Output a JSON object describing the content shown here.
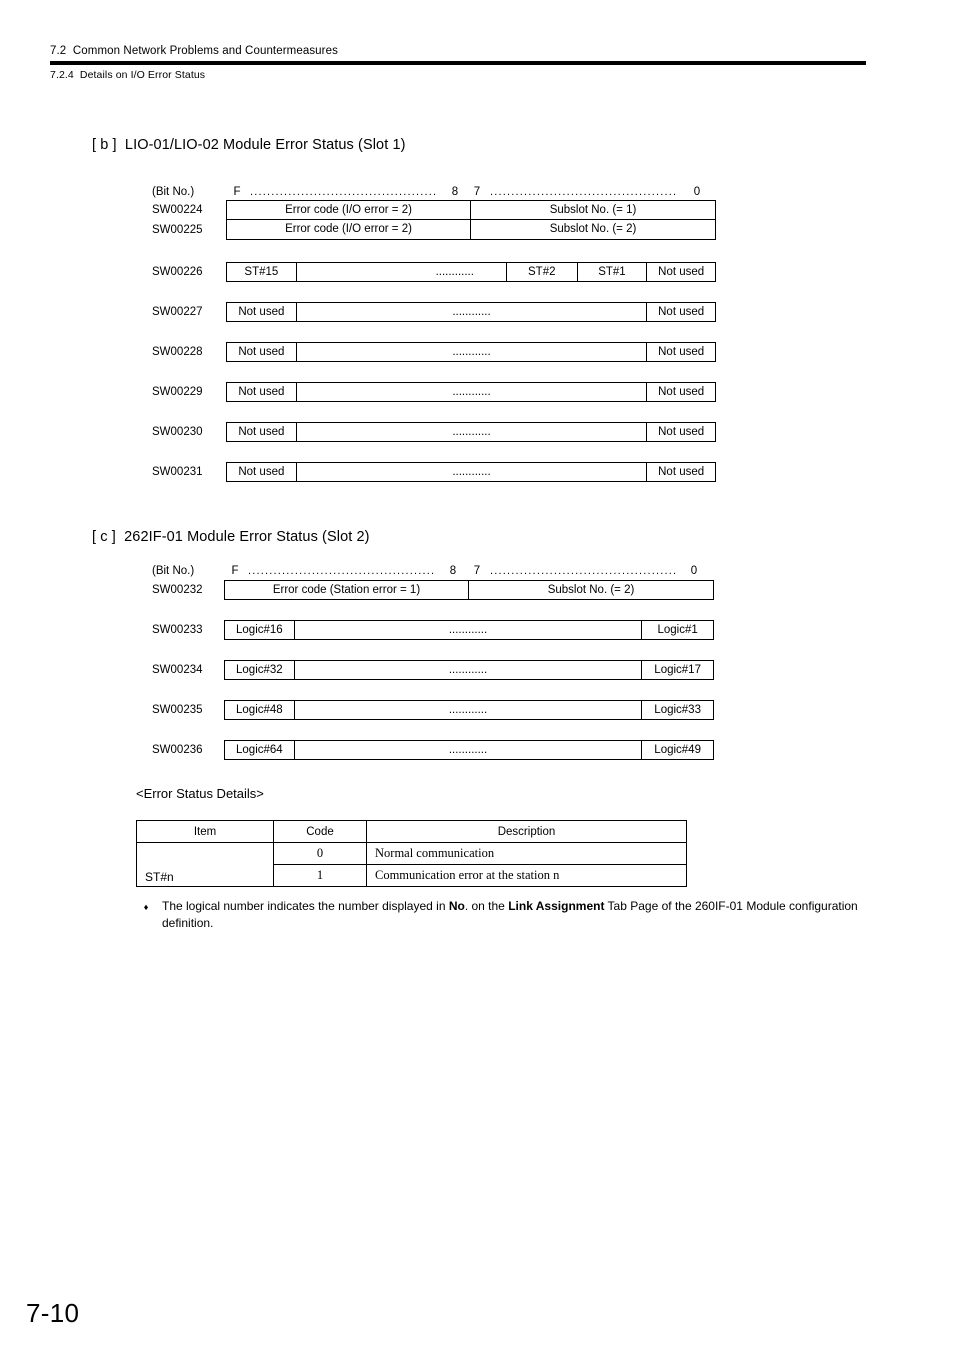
{
  "header": {
    "section": "7.2  Common Network Problems and Countermeasures",
    "subsection": "7.2.4  Details on I/O Error Status"
  },
  "sections": {
    "b": {
      "title": "[ b ]  LIO-01/LIO-02 Module Error Status (Slot 1)",
      "bit_ruler": {
        "label": "(Bit No.)",
        "msb": "F",
        "mid_high": "8",
        "mid_low": "7",
        "lsb": "0",
        "dots": "............................................"
      },
      "rows": [
        {
          "register": "SW00224",
          "cells": [
            {
              "text": "Error code (I/O error = 2)"
            },
            {
              "text": "Subslot No. (= 1)"
            }
          ]
        },
        {
          "register": "SW00225",
          "cells": [
            {
              "text": "Error code (I/O error = 2)"
            },
            {
              "text": "Subslot No. (= 2)"
            }
          ]
        },
        {
          "register": "SW00226",
          "cells": [
            {
              "text": "ST#15"
            },
            {
              "text": "............"
            },
            {
              "text": "ST#2"
            },
            {
              "text": "ST#1"
            },
            {
              "text": "Not used"
            }
          ]
        },
        {
          "register": "SW00227",
          "cells": [
            {
              "text": "Not used"
            },
            {
              "text": "............"
            },
            {
              "text": "Not used"
            }
          ]
        },
        {
          "register": "SW00228",
          "cells": [
            {
              "text": "Not used"
            },
            {
              "text": "............"
            },
            {
              "text": "Not used"
            }
          ]
        },
        {
          "register": "SW00229",
          "cells": [
            {
              "text": "Not used"
            },
            {
              "text": "............"
            },
            {
              "text": "Not used"
            }
          ]
        },
        {
          "register": "SW00230",
          "cells": [
            {
              "text": "Not used"
            },
            {
              "text": "............"
            },
            {
              "text": "Not used"
            }
          ]
        },
        {
          "register": "SW00231",
          "cells": [
            {
              "text": "Not used"
            },
            {
              "text": "............"
            },
            {
              "text": "Not used"
            }
          ]
        }
      ]
    },
    "c": {
      "title": "[ c ]  262IF-01 Module Error Status (Slot 2)",
      "bit_ruler": {
        "label": "(Bit No.)",
        "msb": "F",
        "mid_high": "8",
        "mid_low": "7",
        "lsb": "0",
        "dots": "............................................"
      },
      "rows": [
        {
          "register": "SW00232",
          "cells": [
            {
              "text": "Error code (Station error = 1)"
            },
            {
              "text": "Subslot No. (= 2)"
            }
          ]
        },
        {
          "register": "SW00233",
          "cells": [
            {
              "text": "Logic#16"
            },
            {
              "text": "............"
            },
            {
              "text": "Logic#1"
            }
          ]
        },
        {
          "register": "SW00234",
          "cells": [
            {
              "text": "Logic#32"
            },
            {
              "text": "............"
            },
            {
              "text": "Logic#17"
            }
          ]
        },
        {
          "register": "SW00235",
          "cells": [
            {
              "text": "Logic#48"
            },
            {
              "text": "............"
            },
            {
              "text": "Logic#33"
            }
          ]
        },
        {
          "register": "SW00236",
          "cells": [
            {
              "text": "Logic#64"
            },
            {
              "text": "............"
            },
            {
              "text": "Logic#49"
            }
          ]
        }
      ]
    }
  },
  "error_details": {
    "heading": "<Error Status Details>",
    "columns": [
      "Item",
      "Code",
      "Description"
    ],
    "item": "ST#n",
    "rows": [
      {
        "code": "0",
        "description": "Normal communication"
      },
      {
        "code": "1",
        "description": "Communication error at the station n"
      }
    ]
  },
  "footnote": {
    "bullet": "♦",
    "part1": "The logical number indicates the number displayed in ",
    "bold1": "No",
    "part2": ". on the ",
    "bold2": "Link Assignment",
    "part3": " Tab Page of the 260IF-01 Module configuration definition."
  },
  "page_number": "7-10"
}
